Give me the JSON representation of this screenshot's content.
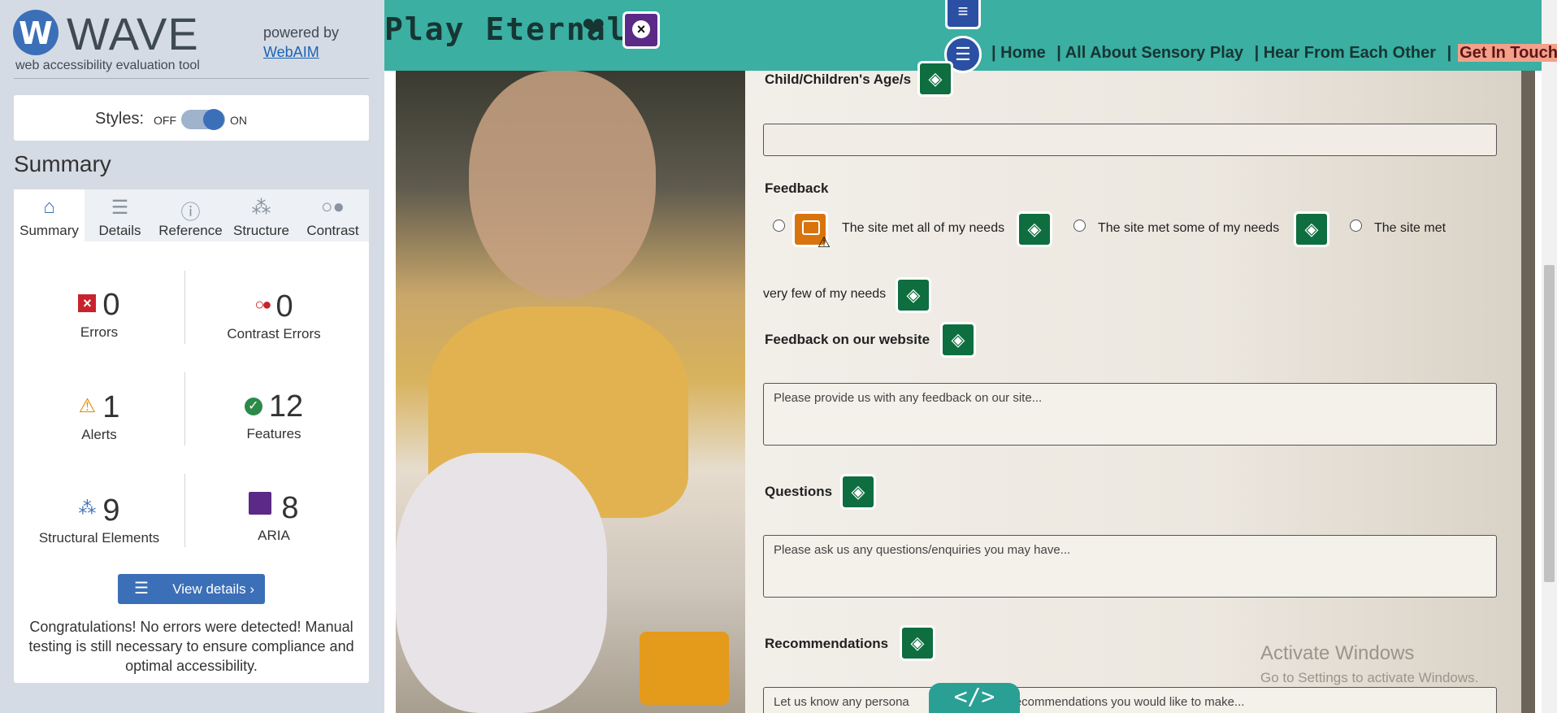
{
  "wave": {
    "logo_letter": "W",
    "title": "WAVE",
    "tagline": "web accessibility evaluation tool",
    "powered_by": "powered by",
    "webaim": "WebAIM",
    "styles_label": "Styles:",
    "styles_off": "OFF",
    "styles_on": "ON",
    "summary_heading": "Summary",
    "tabs": [
      {
        "label": "Summary",
        "icon": "home-icon"
      },
      {
        "label": "Details",
        "icon": "list-icon"
      },
      {
        "label": "Reference",
        "icon": "info-icon"
      },
      {
        "label": "Structure",
        "icon": "structure-icon"
      },
      {
        "label": "Contrast",
        "icon": "contrast-icon"
      }
    ],
    "stats": {
      "errors": {
        "value": "0",
        "label": "Errors"
      },
      "contrast_errors": {
        "value": "0",
        "label": "Contrast Errors"
      },
      "alerts": {
        "value": "1",
        "label": "Alerts"
      },
      "features": {
        "value": "12",
        "label": "Features"
      },
      "structural": {
        "value": "9",
        "label": "Structural Elements"
      },
      "aria": {
        "value": "8",
        "label": "ARIA"
      }
    },
    "view_details": "View details ›",
    "congrats": "Congratulations! No errors were detected! Manual testing is still necessary to ensure compliance and optimal accessibility."
  },
  "site": {
    "brand": "Play Eternal",
    "nav": [
      "| Home",
      "| All About Sensory Play",
      "| Hear From Each Other",
      "|"
    ],
    "nav_cta": "Get In Touch",
    "form": {
      "age_label": "Child/Children's Age/s",
      "feedback_label": "Feedback",
      "radio_1": "The site met all of my needs",
      "radio_2": "The site met some of my needs",
      "radio_3_start": "The site met",
      "radio_3_end": "very few of my needs",
      "website_feedback_label": "Feedback on our website",
      "website_feedback_placeholder": "Please provide us with any feedback on our site...",
      "questions_label": "Questions",
      "questions_placeholder": "Please ask us any questions/enquiries you may have...",
      "recommendations_label": "Recommendations",
      "recommendations_placeholder": "Let us know any persona",
      "recommendations_placeholder_end": "ecommendations you would like to make..."
    },
    "code_toggle": "</>"
  },
  "os": {
    "activate_title": "Activate Windows",
    "activate_sub": "Go to Settings to activate Windows."
  },
  "colors": {
    "wave_blue": "#3b6fb8",
    "site_header": "#3aafa2",
    "feature_green": "#0e6e3f",
    "alert_orange": "#d9740d",
    "aria_purple": "#5b2a86",
    "error_red": "#c8232c"
  }
}
